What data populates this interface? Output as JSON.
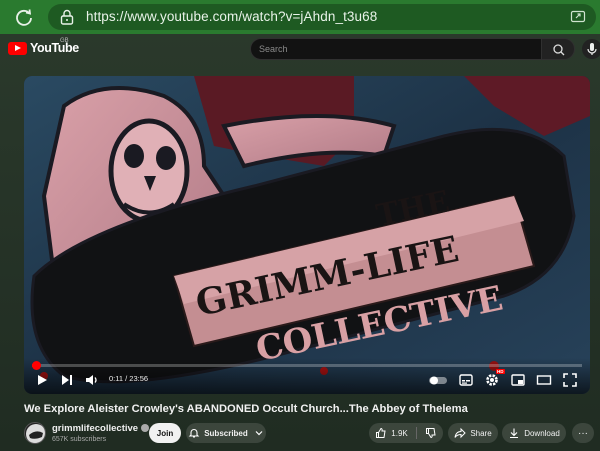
{
  "browser": {
    "url": "https://www.youtube.com/watch?v=jAhdn_t3u68"
  },
  "header": {
    "logo_text": "YouTube",
    "country_code": "GB",
    "search_placeholder": "Search"
  },
  "video": {
    "art_text_line1": "THE",
    "art_text_line2": "GRIMM-LIFE",
    "art_text_line3": "COLLECTIVE",
    "time": "0:11 / 23:56",
    "progress": 0.0077,
    "hd_badge": "HD"
  },
  "info": {
    "title": "We Explore Aleister Crowley's ABANDONED Occult Church...The Abbey of Thelema",
    "channel_name": "grimmlifecollective",
    "subscribers": "657K subscribers",
    "join_label": "Join",
    "subscribed_label": "Subscribed",
    "like_count": "1.9K",
    "share_label": "Share",
    "download_label": "Download",
    "more_label": "···"
  },
  "colors": {
    "browser_green": "#2a7a2f",
    "yt_red": "#ff0000"
  }
}
